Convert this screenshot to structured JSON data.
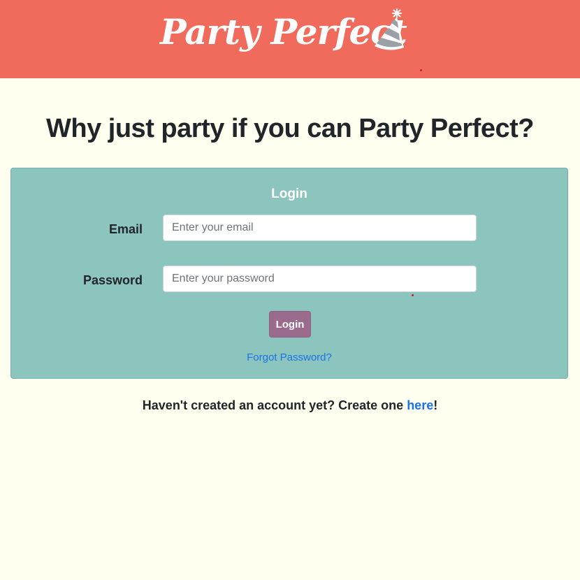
{
  "header": {
    "logo_text": "Party Perfect",
    "logo_icon": "party-hat-icon",
    "background_color": "#f06b5b"
  },
  "main": {
    "tagline": "Why just party if you can Party Perfect?"
  },
  "login_card": {
    "title": "Login",
    "email_label": "Email",
    "email_placeholder": "Enter your email",
    "email_value": "",
    "password_label": "Password",
    "password_placeholder": "Enter your password",
    "password_value": "",
    "login_button_label": "Login",
    "forgot_password_link": "Forgot Password?",
    "background_color": "#8cc5bd",
    "button_color": "#9b6b8e"
  },
  "signup": {
    "prefix": "Haven't created an account yet? Create one ",
    "link_text": "here",
    "suffix": "!",
    "link_color": "#1a73e8"
  },
  "page": {
    "background_color": "#fffff0"
  }
}
